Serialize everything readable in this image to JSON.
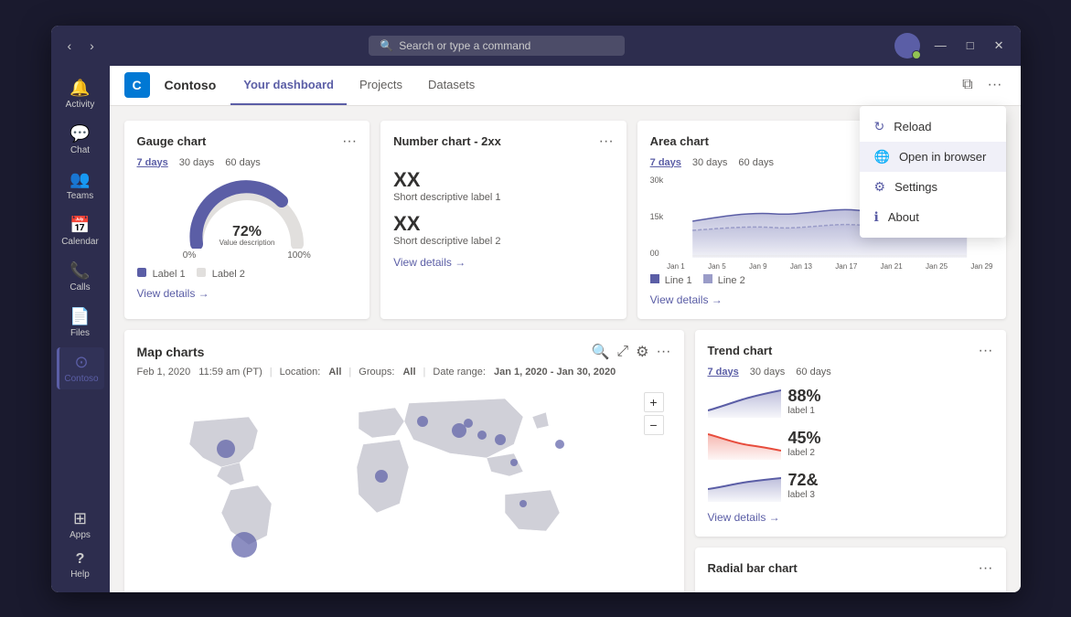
{
  "titlebar": {
    "search_placeholder": "Search or type a command",
    "back_label": "‹",
    "forward_label": "›",
    "minimize_label": "—",
    "maximize_label": "□",
    "close_label": "✕"
  },
  "sidebar": {
    "items": [
      {
        "id": "activity",
        "label": "Activity",
        "icon": "🔔"
      },
      {
        "id": "chat",
        "label": "Chat",
        "icon": "💬"
      },
      {
        "id": "teams",
        "label": "Teams",
        "icon": "👥"
      },
      {
        "id": "calendar",
        "label": "Calendar",
        "icon": "📅"
      },
      {
        "id": "calls",
        "label": "Calls",
        "icon": "📞"
      },
      {
        "id": "files",
        "label": "Files",
        "icon": "📄"
      },
      {
        "id": "contoso",
        "label": "Contoso",
        "icon": "⊙"
      }
    ],
    "bottom_items": [
      {
        "id": "apps",
        "label": "Apps",
        "icon": "⊞"
      },
      {
        "id": "help",
        "label": "Help",
        "icon": "?"
      }
    ]
  },
  "header": {
    "app_logo": "C",
    "app_name": "Contoso",
    "tabs": [
      {
        "id": "dashboard",
        "label": "Your dashboard",
        "active": true
      },
      {
        "id": "projects",
        "label": "Projects",
        "active": false
      },
      {
        "id": "datasets",
        "label": "Datasets",
        "active": false
      }
    ],
    "open_new_label": "⧉",
    "more_label": "···"
  },
  "dropdown": {
    "items": [
      {
        "id": "reload",
        "label": "Reload",
        "icon": "↻"
      },
      {
        "id": "open-in-browser",
        "label": "Open in browser",
        "icon": "🌐",
        "highlighted": true
      },
      {
        "id": "settings",
        "label": "Settings",
        "icon": "⚙"
      },
      {
        "id": "about",
        "label": "About",
        "icon": "ℹ"
      }
    ]
  },
  "gauge_chart": {
    "title": "Gauge chart",
    "time_tabs": [
      "7 days",
      "30 days",
      "60 days"
    ],
    "active_time": "7 days",
    "value": "72%",
    "description": "Value description",
    "min_label": "0%",
    "max_label": "100%",
    "legends": [
      "Label 1",
      "Label 2"
    ],
    "view_details": "View details →"
  },
  "number_chart": {
    "title": "Number chart - 2xx",
    "items": [
      {
        "value": "XX",
        "label": "Short descriptive label 1"
      },
      {
        "value": "XX",
        "label": "Short descriptive label 2"
      }
    ],
    "view_details": "View details →"
  },
  "area_chart": {
    "title": "Area chart",
    "time_tabs": [
      "7 days",
      "30 days",
      "60 days"
    ],
    "active_time": "7 days",
    "y_labels": [
      "30k",
      "15k",
      "00"
    ],
    "x_labels": [
      "Jan 1",
      "Jan 5",
      "Jan 9",
      "Jan 13",
      "Jan 17",
      "Jan 21",
      "Jan 25",
      "Jan 29"
    ],
    "legends": [
      "Line 1",
      "Line 2"
    ],
    "view_details": "View details →"
  },
  "map_chart": {
    "title": "Map charts",
    "date": "Feb 1, 2020",
    "time": "11:59 am (PT)",
    "location_label": "Location:",
    "location_value": "All",
    "groups_label": "Groups:",
    "groups_value": "All",
    "date_range_label": "Date range:",
    "date_range_value": "Jan 1, 2020 - Jan 30, 2020",
    "zoom_in": "+",
    "zoom_out": "−"
  },
  "trend_chart": {
    "title": "Trend chart",
    "time_tabs": [
      "7 days",
      "30 days",
      "60 days"
    ],
    "active_time": "7 days",
    "items": [
      {
        "value": "88%",
        "label": "label 1",
        "color": "#5b5ea6"
      },
      {
        "value": "45%",
        "label": "label 2",
        "color": "#e74c3c"
      },
      {
        "value": "72&",
        "label": "label 3",
        "color": "#5b5ea6"
      }
    ],
    "view_details": "View details →"
  },
  "radial_bar_chart": {
    "title": "Radial bar chart"
  }
}
